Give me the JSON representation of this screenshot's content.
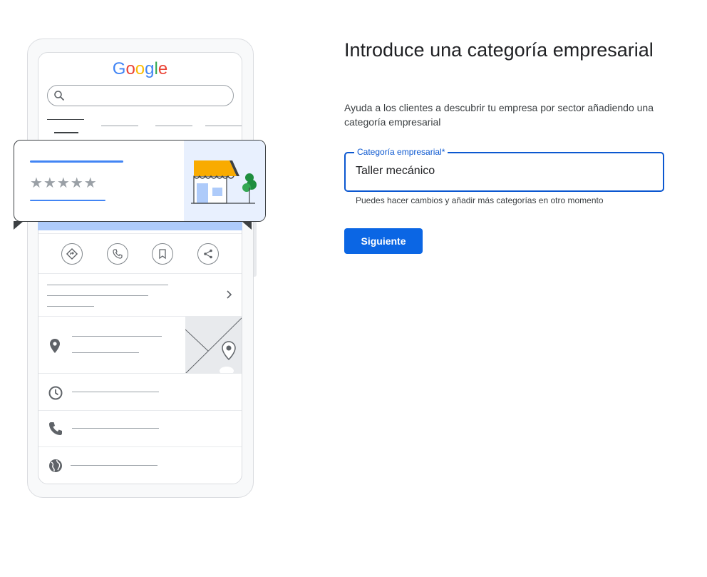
{
  "illustration": {
    "logo_text": "Google",
    "icons": [
      "search-icon",
      "directions-icon",
      "phone-icon",
      "bookmark-icon",
      "share-icon",
      "chevron-right-icon",
      "location-pin-icon",
      "clock-icon",
      "phone-icon",
      "globe-icon",
      "storefront-icon"
    ],
    "stars": "★★★★★"
  },
  "form": {
    "title": "Introduce una categoría empresarial",
    "subtitle": "Ayuda a los clientes a descubrir tu empresa por sector añadiendo una categoría empresarial",
    "field_label": "Categoría empresarial*",
    "field_value": "Taller mecánico",
    "helper_text": "Puedes hacer cambios y añadir más categorías en otro momento",
    "next_label": "Siguiente"
  },
  "colors": {
    "accent": "#0b57d0",
    "button": "#0b66e4",
    "title_text": "#202124"
  }
}
